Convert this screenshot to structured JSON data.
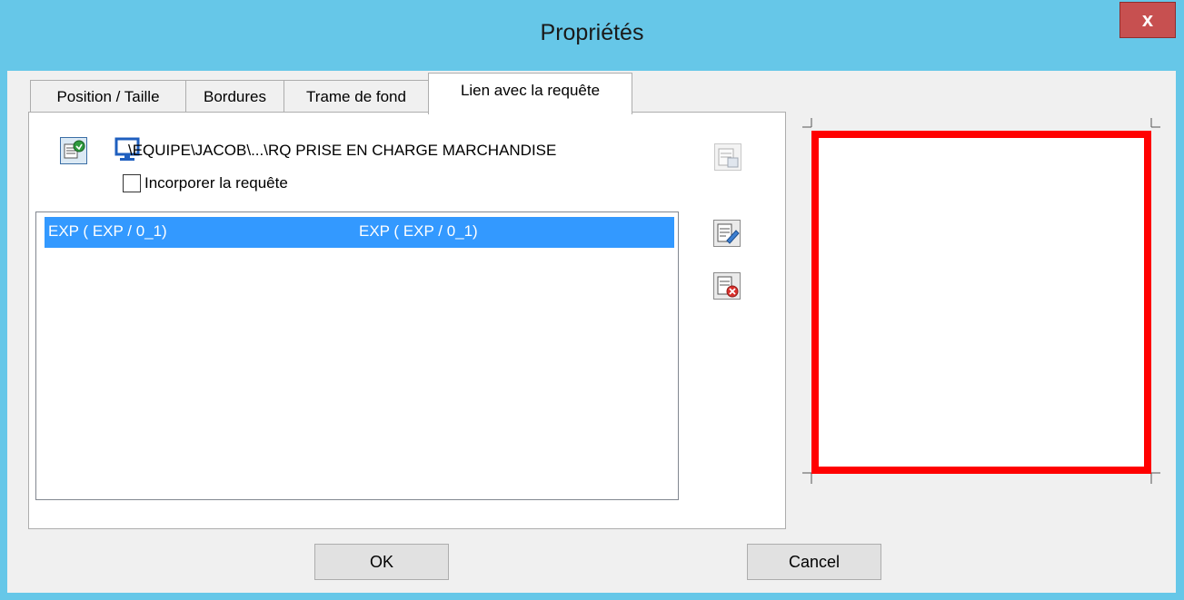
{
  "window": {
    "title": "Propriétés",
    "close_label": "x"
  },
  "tabs": [
    {
      "label": "Position / Taille"
    },
    {
      "label": "Bordures"
    },
    {
      "label": "Trame de fond"
    },
    {
      "label": "Lien avec la requête"
    }
  ],
  "query": {
    "path": "\\EQUIPE\\JACOB\\...\\RQ PRISE EN CHARGE MARCHANDISE",
    "incorporate_label": "Incorporer la requête",
    "incorporate_checked": false
  },
  "list": {
    "rows": [
      {
        "col1": "EXP ( EXP / 0_1)",
        "col2": "EXP ( EXP / 0_1)",
        "selected": true
      }
    ]
  },
  "buttons": {
    "ok": "OK",
    "cancel": "Cancel"
  },
  "colors": {
    "accent": "#66c7e8",
    "selection": "#3399ff",
    "border_preview": "#ff0000"
  },
  "icons": [
    "open-query-icon",
    "computer-icon",
    "save-query-icon",
    "edit-link-icon",
    "delete-link-icon"
  ]
}
